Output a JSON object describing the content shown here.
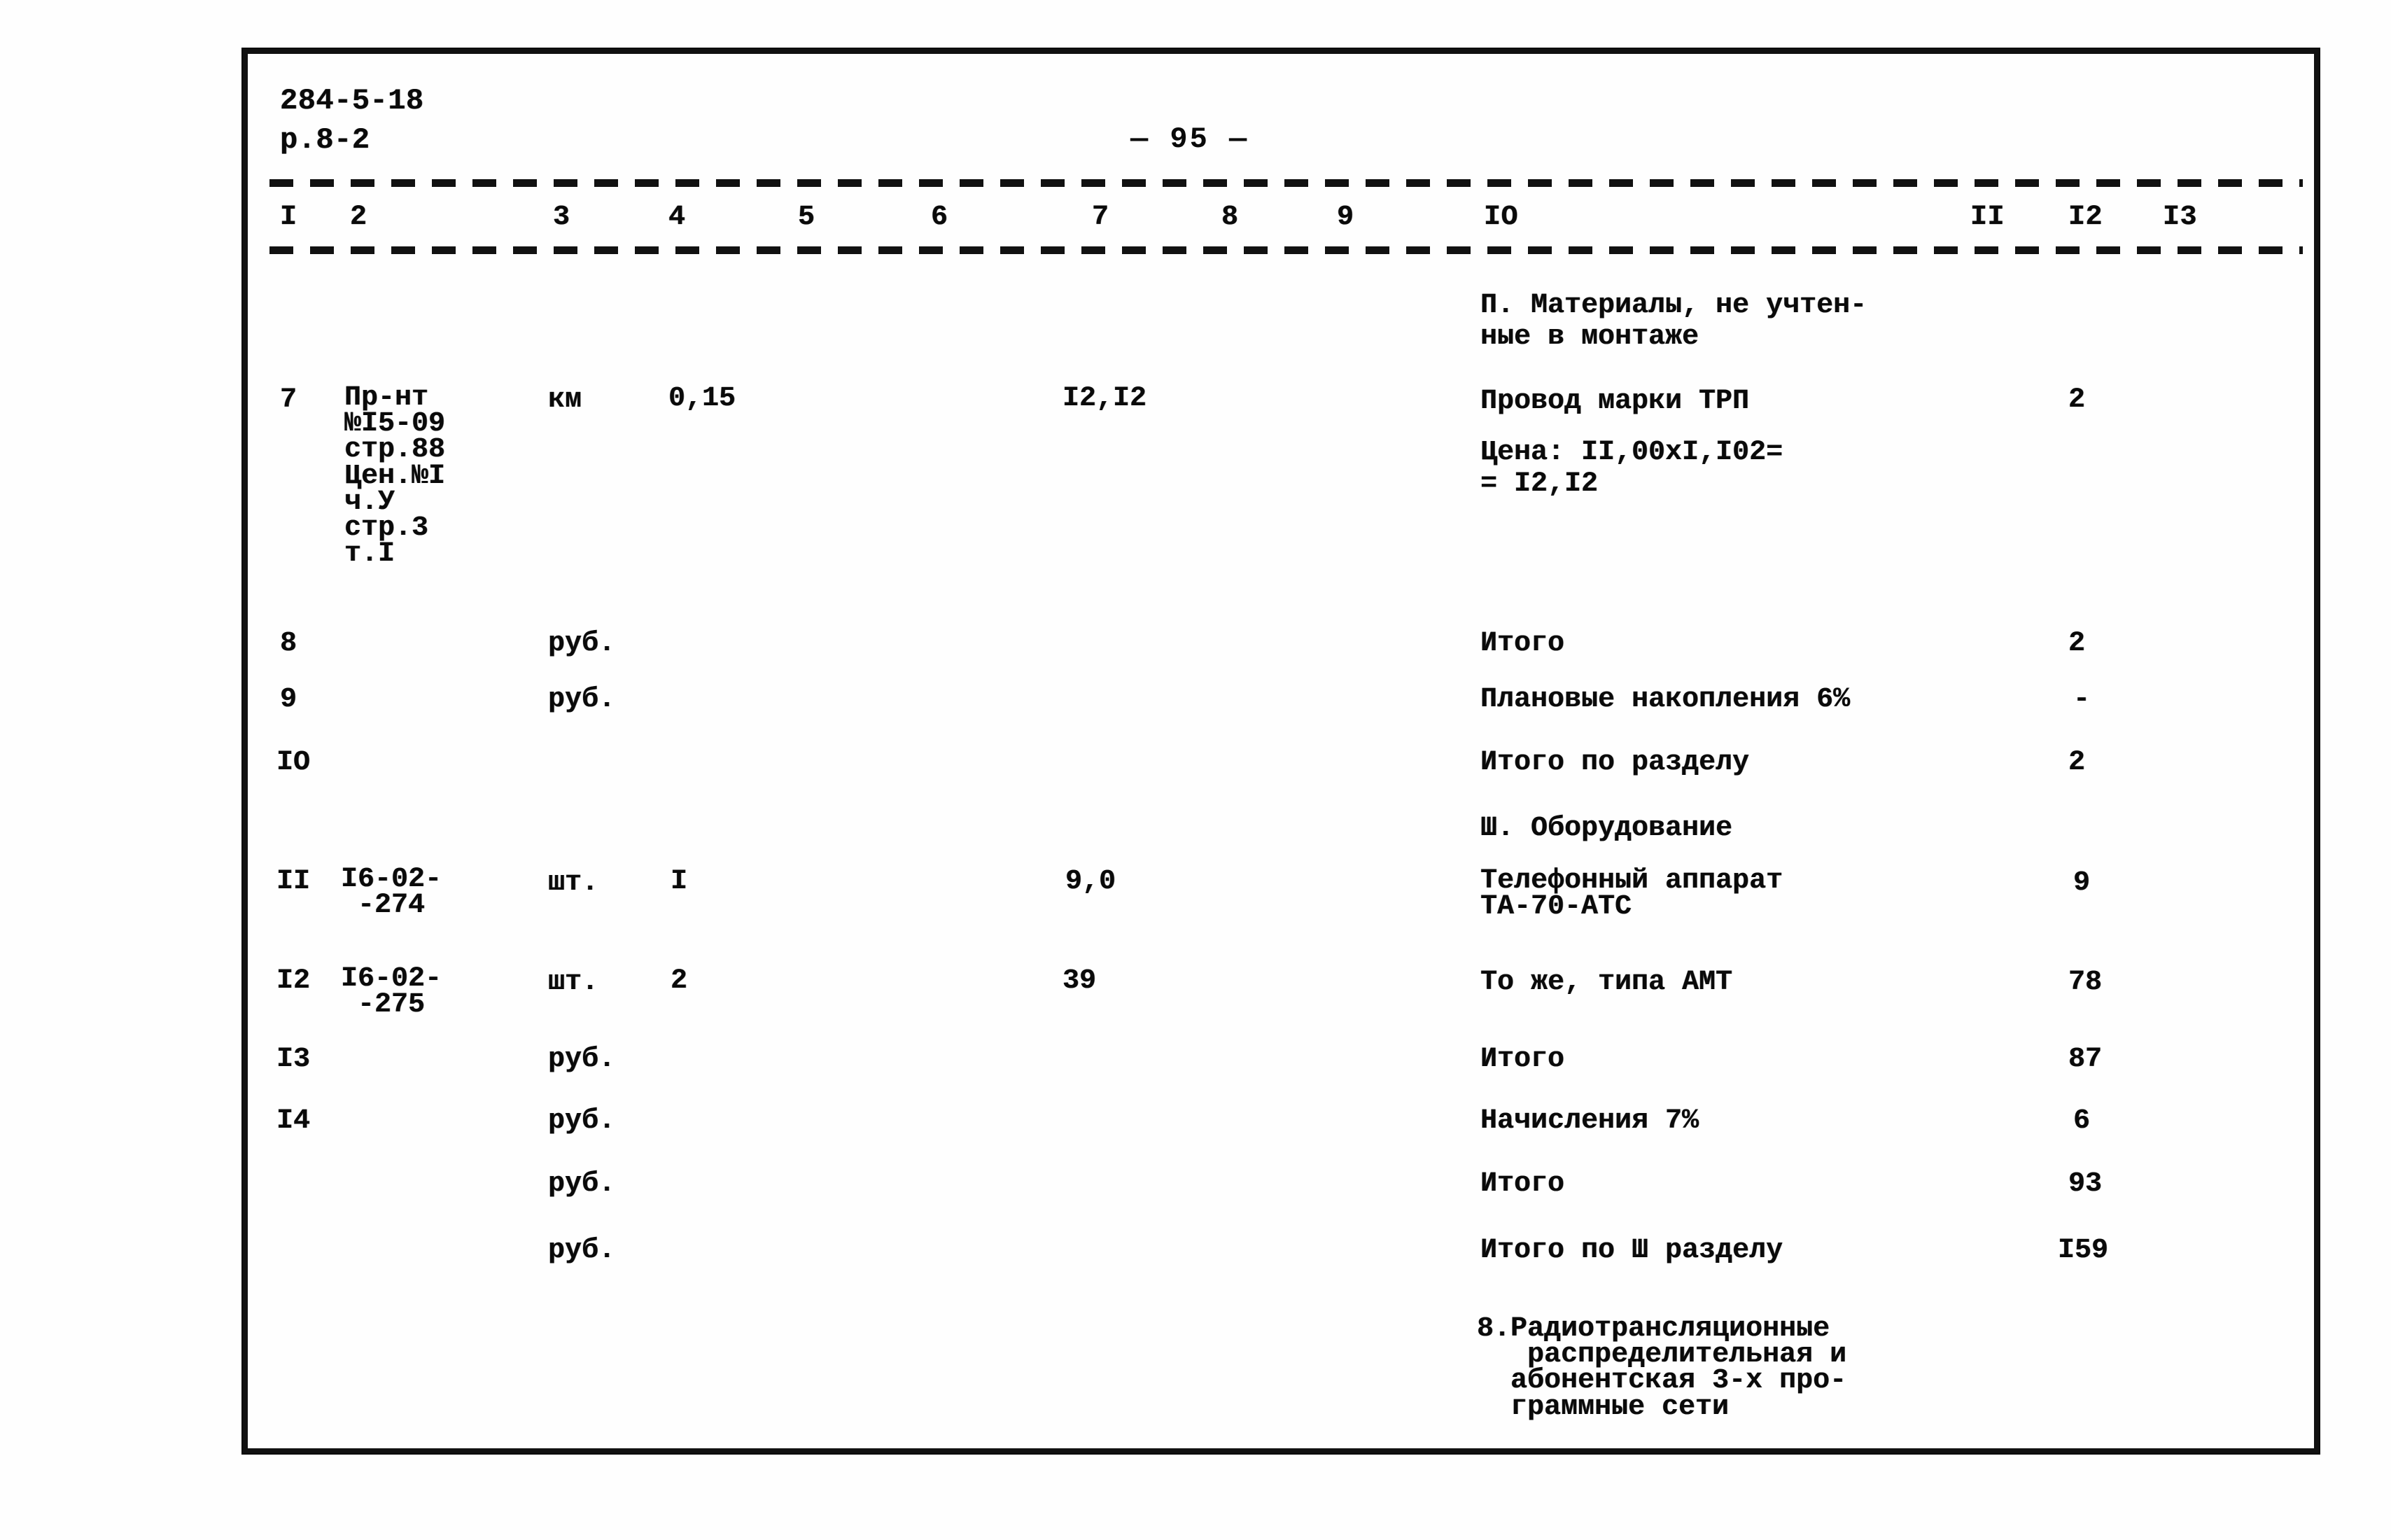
{
  "document": {
    "doc_number": "284-5-18",
    "section_ref": "р.8-2",
    "page_marker": "— 95 —"
  },
  "table": {
    "column_headers": [
      "I",
      "2",
      "3",
      "4",
      "5",
      "6",
      "7",
      "8",
      "9",
      "IO",
      "II",
      "I2",
      "I3"
    ],
    "section_headings": {
      "materials": "П. Материалы, не учтен-\nные в монтаже",
      "equipment": "Ш. Оборудование",
      "next_section": "8.Радиотрансляционные\n   распределительная и\n  абонентская 3-х про-\n  граммные сети"
    },
    "rows": [
      {
        "num": "7",
        "ref": "Пр-нт\n№I5-09\nстр.88\nЦен.№I\nч.У\nстр.3\nт.I",
        "unit": "км",
        "qty": "0,15",
        "price": "I2,I2",
        "name": "Провод марки ТРП",
        "name_note": "Цена: II,00xI,I02=\n= I2,I2",
        "total": "2"
      },
      {
        "num": "8",
        "ref": "",
        "unit": "руб.",
        "qty": "",
        "price": "",
        "name": "Итого",
        "name_note": "",
        "total": "2"
      },
      {
        "num": "9",
        "ref": "",
        "unit": "руб.",
        "qty": "",
        "price": "",
        "name": "Плановые накопления 6%",
        "name_note": "",
        "total": "-"
      },
      {
        "num": "IO",
        "ref": "",
        "unit": "",
        "qty": "",
        "price": "",
        "name": "Итого по разделу",
        "name_note": "",
        "total": "2"
      },
      {
        "num": "II",
        "ref": "I6-02-\n -274",
        "unit": "шт.",
        "qty": "I",
        "price": "9,0",
        "name": "Телефонный аппарат\nТА-70-АТС",
        "name_note": "",
        "total": "9"
      },
      {
        "num": "I2",
        "ref": "I6-02-\n -275",
        "unit": "шт.",
        "qty": "2",
        "price": "39",
        "name": "То же, типа АМТ",
        "name_note": "",
        "total": "78"
      },
      {
        "num": "I3",
        "ref": "",
        "unit": "руб.",
        "qty": "",
        "price": "",
        "name": "Итого",
        "name_note": "",
        "total": "87"
      },
      {
        "num": "I4",
        "ref": "",
        "unit": "руб.",
        "qty": "",
        "price": "",
        "name": "Начисления 7%",
        "name_note": "",
        "total": "6"
      },
      {
        "num": "",
        "ref": "",
        "unit": "руб.",
        "qty": "",
        "price": "",
        "name": "Итого",
        "name_note": "",
        "total": "93"
      },
      {
        "num": "",
        "ref": "",
        "unit": "руб.",
        "qty": "",
        "price": "",
        "name": "Итого по Ш разделу",
        "name_note": "",
        "total": "I59"
      }
    ]
  },
  "colors": {
    "ink": "#0a0a0a",
    "paper": "#fefefe"
  }
}
